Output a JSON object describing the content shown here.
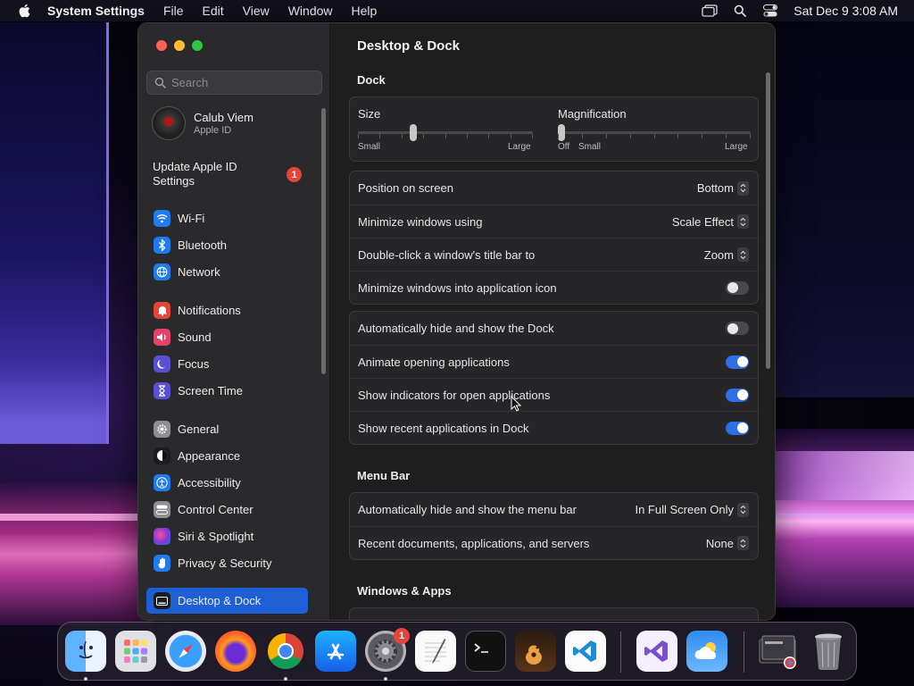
{
  "menubar": {
    "app_name": "System Settings",
    "menus": [
      "File",
      "Edit",
      "View",
      "Window",
      "Help"
    ],
    "clock": "Sat Dec 9  3:08 AM"
  },
  "sidebar": {
    "search_placeholder": "Search",
    "account_name": "Calub Viem",
    "account_sub": "Apple ID",
    "update_text": "Update Apple ID Settings",
    "update_badge": "1",
    "items": [
      {
        "label": "Wi-Fi",
        "icon": "wifi-icon",
        "color": "#1f7cf0"
      },
      {
        "label": "Bluetooth",
        "icon": "bluetooth-icon",
        "color": "#1f7cf0"
      },
      {
        "label": "Network",
        "icon": "globe-icon",
        "color": "#1f7cf0"
      },
      {
        "label": "Notifications",
        "icon": "bell-icon",
        "color": "#e5443a"
      },
      {
        "label": "Sound",
        "icon": "speaker-icon",
        "color": "#e5446a"
      },
      {
        "label": "Focus",
        "icon": "moon-icon",
        "color": "#5b4fd6"
      },
      {
        "label": "Screen Time",
        "icon": "hourglass-icon",
        "color": "#5b4fd6"
      },
      {
        "label": "General",
        "icon": "gear-icon",
        "color": "#8e8e93"
      },
      {
        "label": "Appearance",
        "icon": "appearance-icon",
        "color": "#1c1c1e"
      },
      {
        "label": "Accessibility",
        "icon": "accessibility-icon",
        "color": "#1f7cf0"
      },
      {
        "label": "Control Center",
        "icon": "control-center-icon",
        "color": "#8e8e93"
      },
      {
        "label": "Siri & Spotlight",
        "icon": "siri-icon",
        "color": "#b03aa0"
      },
      {
        "label": "Privacy & Security",
        "icon": "hand-icon",
        "color": "#1f7cf0"
      },
      {
        "label": "Desktop & Dock",
        "icon": "desktop-dock-icon",
        "color": "#1c1c1e"
      }
    ],
    "selected": "Desktop & Dock"
  },
  "main": {
    "title": "Desktop & Dock",
    "dock_section": "Dock",
    "size_label": "Size",
    "size_small": "Small",
    "size_large": "Large",
    "size_value": 0.31,
    "mag_label": "Magnification",
    "mag_off": "Off",
    "mag_small": "Small",
    "mag_large": "Large",
    "mag_value": 0.0,
    "dock_rows": [
      {
        "label": "Position on screen",
        "value": "Bottom"
      },
      {
        "label": "Minimize windows using",
        "value": "Scale Effect"
      },
      {
        "label": "Double-click a window's title bar to",
        "value": "Zoom"
      },
      {
        "label": "Minimize windows into application icon",
        "toggle": false
      }
    ],
    "dock_toggles": [
      {
        "label": "Automatically hide and show the Dock",
        "toggle": false
      },
      {
        "label": "Animate opening applications",
        "toggle": true
      },
      {
        "label": "Show indicators for open applications",
        "toggle": true
      },
      {
        "label": "Show recent applications in Dock",
        "toggle": true
      }
    ],
    "menubar_section": "Menu Bar",
    "menubar_rows": [
      {
        "label": "Automatically hide and show the menu bar",
        "value": "In Full Screen Only"
      },
      {
        "label": "Recent documents, applications, and servers",
        "value": "None"
      }
    ],
    "windows_section": "Windows & Apps"
  },
  "dock": {
    "apps": [
      {
        "name": "Finder",
        "running": true
      },
      {
        "name": "Launchpad",
        "running": false
      },
      {
        "name": "Safari",
        "running": false
      },
      {
        "name": "Firefox",
        "running": false
      },
      {
        "name": "Chrome",
        "running": true
      },
      {
        "name": "App Store",
        "running": false
      },
      {
        "name": "System Settings",
        "running": true,
        "badge": "1"
      },
      {
        "name": "TextEdit",
        "running": false
      },
      {
        "name": "Terminal",
        "running": false
      },
      {
        "name": "GarageBand",
        "running": false
      },
      {
        "name": "Visual Studio Code",
        "running": false
      },
      {
        "name": "Visual Studio",
        "running": false
      },
      {
        "name": "Weather",
        "running": false
      },
      {
        "name": "Downloads",
        "running": false
      },
      {
        "name": "Trash",
        "running": false
      }
    ]
  }
}
